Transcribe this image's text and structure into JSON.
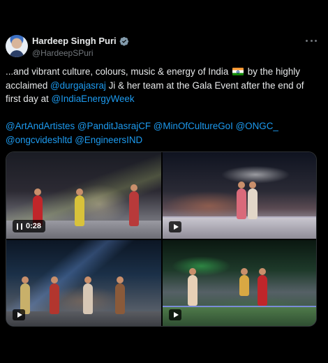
{
  "author": {
    "name": "Hardeep Singh Puri",
    "handle": "@HardeepSPuri"
  },
  "tweet": {
    "line1_pre": "...and vibrant culture, colours, music & energy of India",
    "line1_post": "by the highly",
    "line2_pre": "acclaimed",
    "mention_durga": "@durgajasraj",
    "line2_post": "Ji & her team at the Gala Event after the end of",
    "line3_pre": "first day at",
    "mention_energy": "@IndiaEnergyWeek",
    "mentions_row1": [
      "@ArtAndArtistes",
      "@PanditJasrajCF",
      "@MinOfCultureGoI",
      "@ONGC_"
    ],
    "mentions_row2": [
      "@ongcvideshltd",
      "@EngineersIND"
    ]
  },
  "media": {
    "video1_time": "0:28"
  },
  "icons": {
    "verified": "verified-badge-icon",
    "more": "more-options-icon",
    "flag": "india-flag-icon",
    "pause": "pause-icon",
    "play": "play-icon"
  },
  "colors": {
    "background": "#000000",
    "text": "#e7e9ea",
    "secondary": "#71767b",
    "link": "#1d9bf0"
  }
}
